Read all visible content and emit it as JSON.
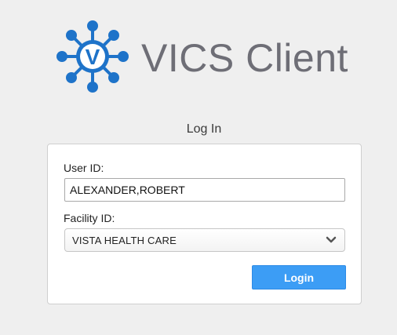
{
  "header": {
    "app_title": "VICS Client",
    "logo_letter": "V",
    "logo_icon": "network-hub-logo-icon",
    "logo_color": "#1e73c9"
  },
  "form": {
    "heading": "Log In",
    "user_id_label": "User ID:",
    "user_id_value": "ALEXANDER,ROBERT",
    "facility_id_label": "Facility ID:",
    "facility_value": "VISTA HEALTH CARE",
    "facility_dropdown_icon": "chevron-down-icon",
    "login_label": "Login",
    "login_button_color": "#3c9df5"
  }
}
